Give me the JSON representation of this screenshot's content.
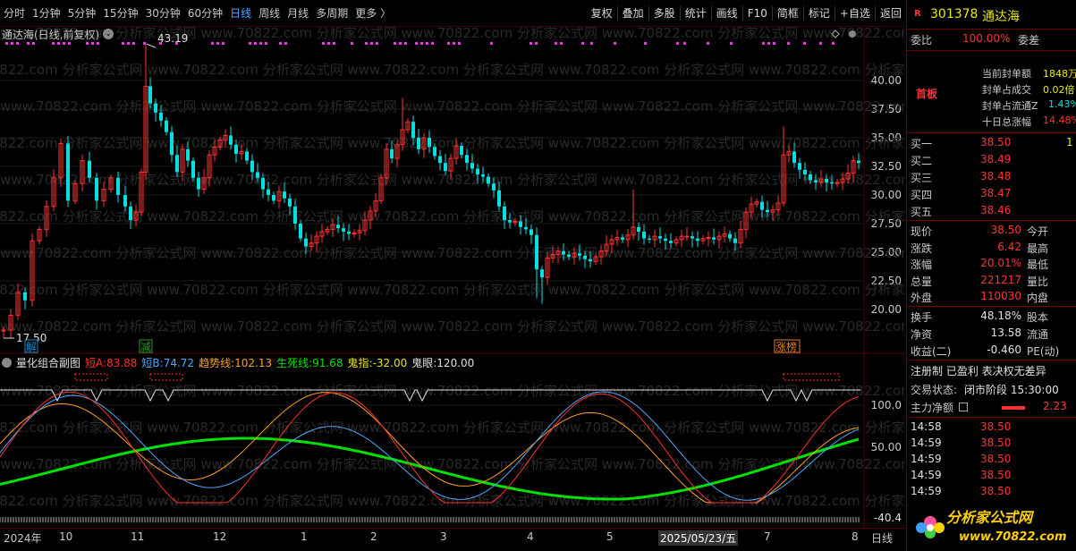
{
  "toolbar": {
    "left": [
      "分时",
      "1分钟",
      "5分钟",
      "15分钟",
      "30分钟",
      "60分钟",
      "日线",
      "周线",
      "月线",
      "多周期",
      "更多 〉"
    ],
    "active": "日线",
    "right": [
      "复权",
      "叠加",
      "多股",
      "统计",
      "画线",
      "F10",
      "简框",
      "标记",
      "+自选",
      "返回"
    ]
  },
  "main": {
    "title": "通达海(日线,前复权)",
    "high_label": "43.19",
    "low_label": "17.50",
    "yticks": [
      "40.00",
      "37.50",
      "35.00",
      "32.50",
      "30.00",
      "27.50",
      "25.00",
      "22.50",
      "20.00"
    ],
    "markers": [
      "解",
      "减",
      "涨榜"
    ],
    "watermark": "www.70822.com 分析家公式网"
  },
  "indicator": {
    "name": "量化组合副图",
    "items": [
      {
        "label": "短A:",
        "value": "83.88",
        "color": "#ff3030"
      },
      {
        "label": "短B:",
        "value": "74.72",
        "color": "#4fa6ff"
      },
      {
        "label": "趋势线:",
        "value": "102.13",
        "color": "#ffa020"
      },
      {
        "label": "生死线:",
        "value": "91.68",
        "color": "#00e000"
      },
      {
        "label": "鬼指:",
        "value": "-32.00",
        "color": "#e8e800"
      },
      {
        "label": "鬼眼:",
        "value": "120.00",
        "color": "#e0e0e0"
      }
    ],
    "yticks": [
      "100.0",
      "50.00"
    ],
    "bottom_value": "-40.4"
  },
  "datebar": {
    "labels": [
      "2024年",
      "10",
      "11",
      "12",
      "1",
      "2",
      "3",
      "4",
      "5",
      "6",
      "7",
      "8"
    ],
    "cursor_date": "2025/05/23/五",
    "right_label": "日线"
  },
  "quote": {
    "code": "301378",
    "name": "通达海",
    "weibi_label": "委比",
    "weibi_value": "100.00%",
    "weicha_label": "委差",
    "board_tag": "首板",
    "seal_items": [
      {
        "label": "当前封单额",
        "value": "1848万"
      },
      {
        "label": "封单占成交",
        "value": "0.02倍"
      },
      {
        "label": "封单占流通Z",
        "value": "1.43%"
      },
      {
        "label": "十日总涨幅",
        "value": "14.48%"
      }
    ],
    "bids": [
      {
        "label": "买一",
        "price": "38.50",
        "vol": "1"
      },
      {
        "label": "买二",
        "price": "38.49",
        "vol": ""
      },
      {
        "label": "买三",
        "price": "38.48",
        "vol": ""
      },
      {
        "label": "买四",
        "price": "38.47",
        "vol": ""
      },
      {
        "label": "买五",
        "price": "38.46",
        "vol": ""
      }
    ],
    "stats": [
      {
        "l": "现价",
        "v": "38.50",
        "r": "今开"
      },
      {
        "l": "涨跌",
        "v": "6.42",
        "r": "最高"
      },
      {
        "l": "涨幅",
        "v": "20.01%",
        "r": "最低"
      },
      {
        "l": "总量",
        "v": "221217",
        "r": "量比"
      },
      {
        "l": "外盘",
        "v": "110030",
        "r": "内盘"
      }
    ],
    "stats2": [
      {
        "l": "换手",
        "v": "48.18%",
        "r": "股本"
      },
      {
        "l": "净资",
        "v": "13.58",
        "r": "流通"
      },
      {
        "l": "收益(二)",
        "v": "-0.460",
        "r": "PE(动)"
      }
    ],
    "reg_line": "注册制 已盈利 表决权无差异",
    "status_label": "交易状态:",
    "status_value": "闭市阶段 15:30:00",
    "netflow_label": "主力净额",
    "netflow_value": "2.23",
    "ticks": [
      {
        "t": "14:58",
        "p": "38.50"
      },
      {
        "t": "14:59",
        "p": "38.50"
      },
      {
        "t": "14:59",
        "p": "38.50"
      },
      {
        "t": "14:59",
        "p": "38.50"
      },
      {
        "t": "14:59",
        "p": "38.50"
      }
    ]
  },
  "logo": {
    "text": "分析家公式网",
    "url": "www.70822.com"
  },
  "colors": {
    "up": "#ff3232",
    "down": "#00e0e0",
    "border": "#6b0000",
    "green": "#00e000",
    "orange": "#ffa020",
    "blue": "#4fa6ff"
  }
}
